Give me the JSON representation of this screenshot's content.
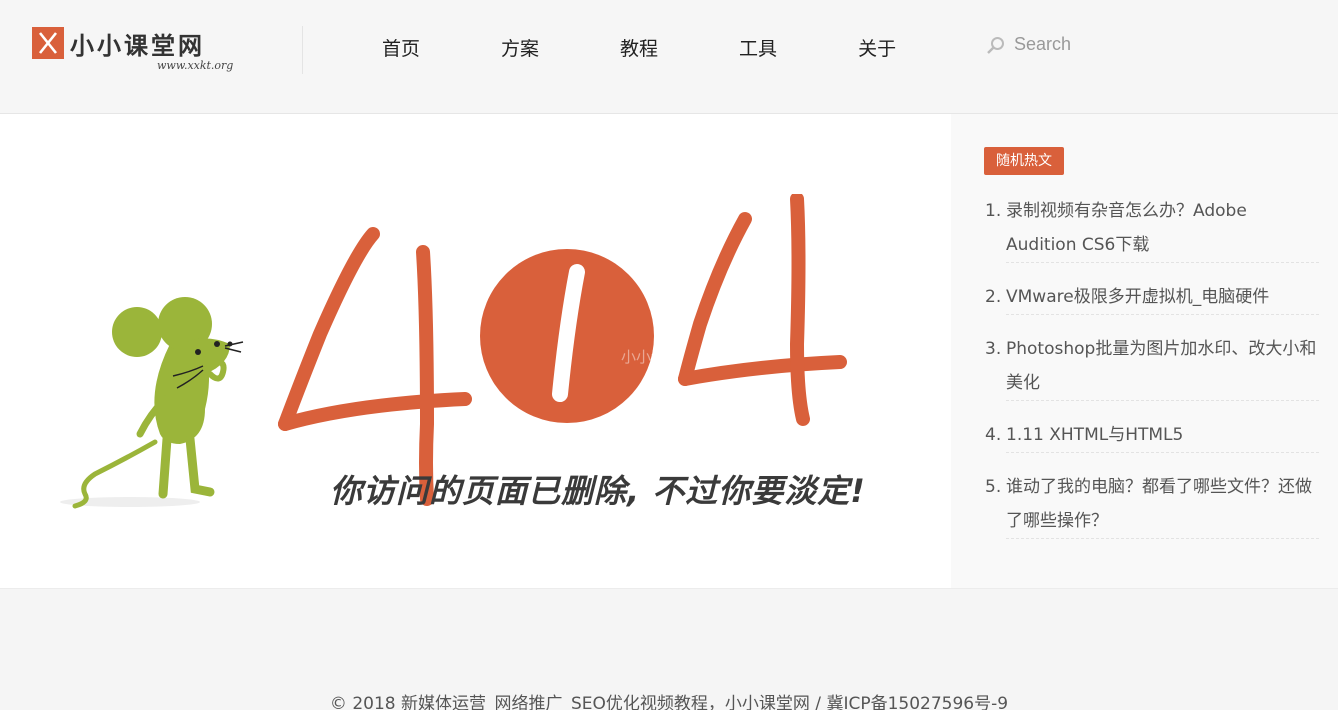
{
  "site": {
    "logo_text": "小小课堂网",
    "logo_url": "www.xxkt.org"
  },
  "nav": {
    "items": [
      {
        "label": "首页"
      },
      {
        "label": "方案"
      },
      {
        "label": "教程"
      },
      {
        "label": "工具"
      },
      {
        "label": "关于"
      }
    ]
  },
  "search": {
    "placeholder": "Search"
  },
  "error": {
    "code_digit_1": "4",
    "code_digit_2": "0",
    "code_digit_3": "4",
    "message": "你访问的页面已删除, 不过你要淡定!",
    "watermark": "小小课堂"
  },
  "sidebar": {
    "title": "随机热文",
    "items": [
      {
        "num": "1.",
        "title": "录制视频有杂音怎么办？Adobe Audition CS6下载"
      },
      {
        "num": "2.",
        "title": "VMware极限多开虚拟机_电脑硬件"
      },
      {
        "num": "3.",
        "title": "Photoshop批量为图片加水印、改大小和美化"
      },
      {
        "num": "4.",
        "title": "1.11 XHTML与HTML5"
      },
      {
        "num": "5.",
        "title": "谁动了我的电脑？都看了哪些文件？还做了哪些操作？"
      }
    ]
  },
  "footer": {
    "text": "© 2018 新媒体运营_网络推广_SEO优化视频教程，小小课堂网 / 冀ICP备15027596号-9"
  },
  "colors": {
    "accent": "#d9603b",
    "mouse_green": "#9bb53a"
  }
}
